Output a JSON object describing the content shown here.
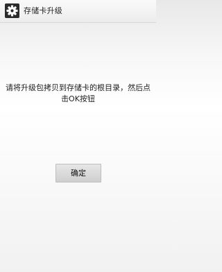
{
  "header": {
    "icon": "gear-icon",
    "title": "存储卡升级"
  },
  "dialog": {
    "message_line1": "请将升级包拷贝到存储卡的根目录，然后点",
    "message_line2": "击OK按钮",
    "confirm_label": "确定"
  }
}
